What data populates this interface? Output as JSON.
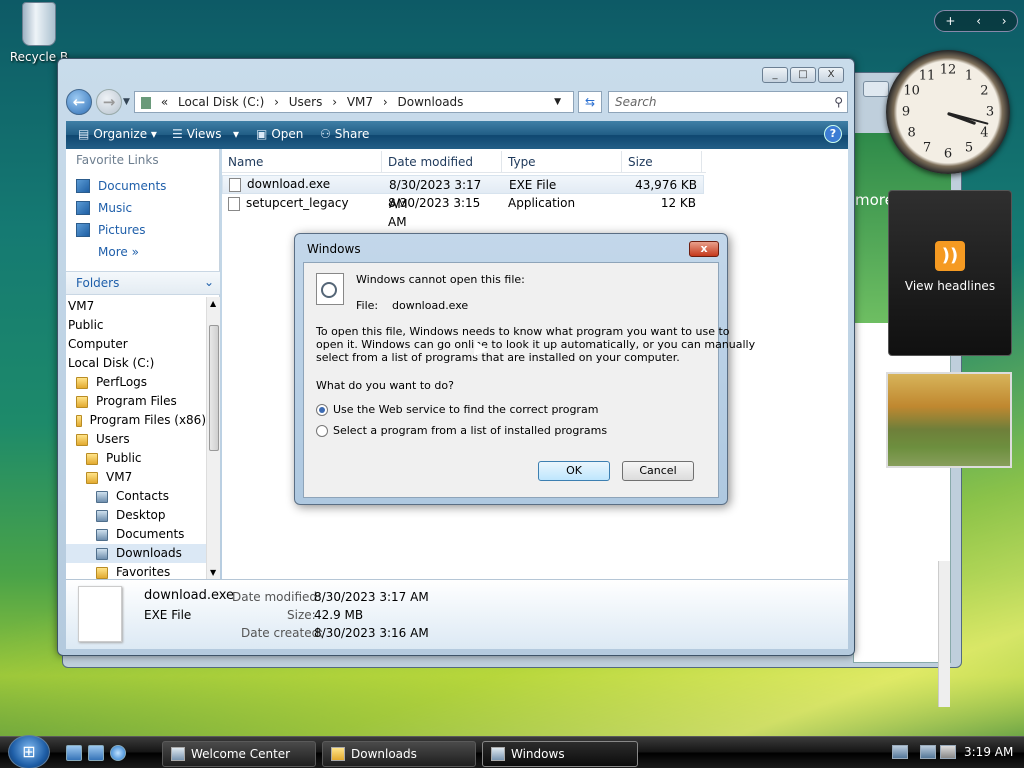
{
  "desktop": {
    "recycle_label": "Recycle B"
  },
  "explorer": {
    "window_buttons": [
      "_",
      "□",
      "X"
    ],
    "address": [
      "«",
      "Local Disk (C:)",
      "›",
      "Users",
      "›",
      "VM7",
      "›",
      "Downloads"
    ],
    "search_placeholder": "Search",
    "toolbar": {
      "organize": "Organize",
      "views": "Views",
      "open": "Open",
      "share": "Share",
      "help": "?"
    },
    "favorites_header": "Favorite Links",
    "favorites": [
      "Documents",
      "Music",
      "Pictures",
      "More"
    ],
    "folders_header": "Folders",
    "tree": [
      {
        "label": "VM7",
        "indent": 0,
        "icon": "none"
      },
      {
        "label": "Public",
        "indent": 0,
        "icon": "none"
      },
      {
        "label": "Computer",
        "indent": 0,
        "icon": "none"
      },
      {
        "label": "Local Disk (C:)",
        "indent": 0,
        "icon": "none"
      },
      {
        "label": "PerfLogs",
        "indent": 1,
        "icon": "folder"
      },
      {
        "label": "Program Files",
        "indent": 1,
        "icon": "folder"
      },
      {
        "label": "Program Files (x86)",
        "indent": 1,
        "icon": "folder"
      },
      {
        "label": "Users",
        "indent": 1,
        "icon": "folder"
      },
      {
        "label": "Public",
        "indent": 2,
        "icon": "folder"
      },
      {
        "label": "VM7",
        "indent": 2,
        "icon": "folder"
      },
      {
        "label": "Contacts",
        "indent": 3,
        "icon": "special"
      },
      {
        "label": "Desktop",
        "indent": 3,
        "icon": "special"
      },
      {
        "label": "Documents",
        "indent": 3,
        "icon": "special"
      },
      {
        "label": "Downloads",
        "indent": 3,
        "icon": "special",
        "selected": true
      },
      {
        "label": "Favorites",
        "indent": 3,
        "icon": "folder"
      }
    ],
    "columns": {
      "name": "Name",
      "date": "Date modified",
      "type": "Type",
      "size": "Size"
    },
    "files": [
      {
        "name": "download.exe",
        "date": "8/30/2023 3:17 AM",
        "type": "EXE File",
        "size": "43,976 KB",
        "selected": true
      },
      {
        "name": "setupcert_legacy",
        "date": "8/30/2023 3:15 AM",
        "type": "Application",
        "size": "12 KB",
        "selected": false
      }
    ],
    "details": {
      "filename": "download.exe",
      "filetype": "EXE File",
      "date_modified_label": "Date modified:",
      "date_modified": "8/30/2023 3:17 AM",
      "size_label": "Size:",
      "size": "42.9 MB",
      "date_created_label": "Date created:",
      "date_created": "8/30/2023 3:16 AM"
    }
  },
  "dialog": {
    "title": "Windows",
    "close": "x",
    "heading": "Windows cannot open this file:",
    "file_label": "File:",
    "file_name": "download.exe",
    "para1": "To open this file, Windows needs to know what program you want to use to",
    "para2": "open it.  Windows can go online to look it up automatically, or you can manually",
    "para3": "select from a list of programs that are installed on your computer.",
    "question": "What do you want to do?",
    "option1": "Use the Web service to find the correct program",
    "option2": "Select a program from a list of installed programs",
    "ok": "OK",
    "cancel": "Cancel"
  },
  "gadgets": {
    "headlines": "View headlines",
    "clock_numbers": [
      "12",
      "1",
      "2",
      "3",
      "4",
      "5",
      "6",
      "7",
      "8",
      "9",
      "10",
      "11"
    ],
    "sidebar_controls": [
      "+",
      "‹",
      "›"
    ]
  },
  "background_window": {
    "text": "more"
  },
  "taskbar": {
    "tasks": [
      "Welcome Center",
      "Downloads",
      "Windows"
    ],
    "time": "3:19 AM"
  }
}
